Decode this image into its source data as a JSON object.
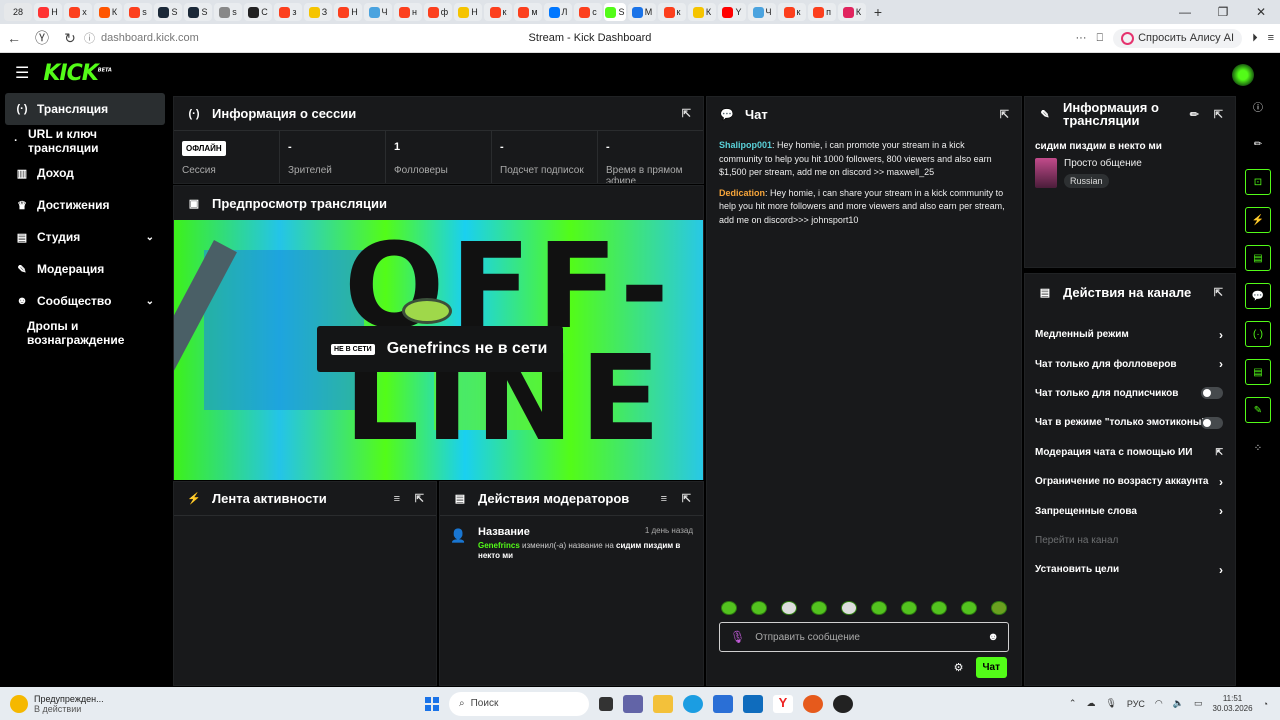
{
  "browser": {
    "tabs": [
      {
        "label": "28",
        "icon": "count-badge",
        "color": "#e6e8ea"
      },
      {
        "label": "Н",
        "icon": "yandex-icon",
        "color": "#ff3333"
      },
      {
        "label": "x",
        "icon": "yandex-icon",
        "color": "#fc3f1d"
      },
      {
        "label": "К",
        "icon": "kinopoisk-icon",
        "color": "#f50"
      },
      {
        "label": "s",
        "icon": "yandex-icon",
        "color": "#fc3f1d"
      },
      {
        "label": "S",
        "icon": "steam-icon",
        "color": "#1b2838"
      },
      {
        "label": "S",
        "icon": "steam-icon",
        "color": "#1b2838"
      },
      {
        "label": "s",
        "icon": "generic-icon",
        "color": "#888"
      },
      {
        "label": "С",
        "icon": "generic-icon",
        "color": "#222"
      },
      {
        "label": "з",
        "icon": "yandex-icon",
        "color": "#fc3f1d"
      },
      {
        "label": "З",
        "icon": "yellow-icon",
        "color": "#f5c400"
      },
      {
        "label": "Н",
        "icon": "yandex-icon",
        "color": "#fc3f1d"
      },
      {
        "label": "Ч",
        "icon": "image-icon",
        "color": "#4aa3df"
      },
      {
        "label": "н",
        "icon": "yandex-icon",
        "color": "#fc3f1d"
      },
      {
        "label": "ф",
        "icon": "yandex-icon",
        "color": "#fc3f1d"
      },
      {
        "label": "Н",
        "icon": "yellow-icon",
        "color": "#f5c400"
      },
      {
        "label": "к",
        "icon": "yandex-icon",
        "color": "#fc3f1d"
      },
      {
        "label": "м",
        "icon": "yandex-icon",
        "color": "#fc3f1d"
      },
      {
        "label": "Л",
        "icon": "vk-icon",
        "color": "#0077ff"
      },
      {
        "label": "с",
        "icon": "yandex-icon",
        "color": "#fc3f1d"
      },
      {
        "label": "S",
        "icon": "kick-icon",
        "color": "#53fc18"
      },
      {
        "label": "М",
        "icon": "mail-icon",
        "color": "#1a73e8"
      },
      {
        "label": "к",
        "icon": "yandex-icon",
        "color": "#fc3f1d"
      },
      {
        "label": "К",
        "icon": "yellow-icon",
        "color": "#f5c400"
      },
      {
        "label": "Y",
        "icon": "youtube-icon",
        "color": "#ff0000"
      },
      {
        "label": "Ч",
        "icon": "image-icon",
        "color": "#4aa3df"
      },
      {
        "label": "к",
        "icon": "yandex-icon",
        "color": "#fc3f1d"
      },
      {
        "label": "п",
        "icon": "yandex-icon",
        "color": "#fc3f1d"
      },
      {
        "label": "К",
        "icon": "twitch-icon",
        "color": "#e0245e"
      }
    ],
    "url": "dashboard.kick.com",
    "page_title": "Stream - Kick Dashboard",
    "alice_label": "Спросить Алису AI"
  },
  "app": {
    "logo": "KICK",
    "logo_badge": "BETA",
    "accent": "#53fc18"
  },
  "sidebar": {
    "items": [
      {
        "label": "Трансляция",
        "icon": "broadcast-icon",
        "glyph": "(·)",
        "active": true
      },
      {
        "label": "URL и ключ трансляции",
        "icon": "",
        "glyph": "·"
      },
      {
        "label": "Доход",
        "icon": "chart-icon",
        "glyph": "▥"
      },
      {
        "label": "Достижения",
        "icon": "trophy-icon",
        "glyph": "♛"
      },
      {
        "label": "Студия",
        "icon": "studio-icon",
        "glyph": "▤",
        "chevron": "⌄"
      },
      {
        "label": "Модерация",
        "icon": "wrench-icon",
        "glyph": "✎"
      },
      {
        "label": "Сообщество",
        "icon": "community-icon",
        "glyph": "☻",
        "chevron": "⌄"
      },
      {
        "label": "Дропы и вознаграждение",
        "icon": "",
        "glyph": ""
      }
    ]
  },
  "session": {
    "title": "Информация о сессии",
    "status_badge": "ОФЛАЙН",
    "stats": [
      {
        "value": "",
        "label": "Сессия"
      },
      {
        "value": "-",
        "label": "Зрителей"
      },
      {
        "value": "1",
        "label": "Фолловеры"
      },
      {
        "value": "-",
        "label": "Подсчет подписок"
      },
      {
        "value": "-",
        "label": "Время в прямом эфире"
      }
    ]
  },
  "preview": {
    "title": "Предпросмотр трансляции",
    "offline_art_text": "OFF-\nLINE",
    "offline_badge": "НЕ В СЕТИ",
    "offline_message": "Genefrincs не в сети"
  },
  "activity": {
    "title": "Лента активности"
  },
  "mod_actions": {
    "title": "Действия модераторов",
    "entries": [
      {
        "title": "Название",
        "time": "1 день назад",
        "user": "Genefrincs",
        "action": " изменил(-а) название на ",
        "value": "сидим пиздим в некто ми"
      }
    ]
  },
  "chat": {
    "title": "Чат",
    "messages": [
      {
        "user": "Shalipop001",
        "text": ": Hey homie, i can promote your stream in a kick community to help you hit 1000 followers, 800 viewers and also earn $1,500 per stream, add me on discord >> maxwell_25"
      },
      {
        "user": "Dedication",
        "text": ": Hey homie, i can share your stream in a kick community to help you hit more followers and more viewers and also earn per stream, add me on discord>>> johnsport10"
      }
    ],
    "input_placeholder": "Отправить сообщение",
    "send_label": "Чат"
  },
  "stream_info": {
    "title": "Информация о трансляции",
    "stream_title": "сидим пиздим в некто ми",
    "category": "Просто общение",
    "language_tag": "Russian"
  },
  "channel_actions": {
    "title": "Действия на канале",
    "items": [
      {
        "label": "Медленный режим",
        "control": "chevron"
      },
      {
        "label": "Чат только для фолловеров",
        "control": "chevron"
      },
      {
        "label": "Чат только для подписчиков",
        "control": "toggle",
        "on": false
      },
      {
        "label": "Чат в режиме \"только эмотиконы\"",
        "control": "toggle",
        "on": false
      },
      {
        "label": "Модерация чата с помощью ИИ",
        "control": "external"
      },
      {
        "label": "Ограничение по возрасту аккаунта",
        "control": "chevron"
      },
      {
        "label": "Запрещенные слова",
        "control": "chevron"
      },
      {
        "label": "Перейти на канал",
        "control": "none",
        "disabled": true
      },
      {
        "label": "Установить цели",
        "control": "chevron"
      }
    ]
  },
  "taskbar": {
    "notification_title": "Предупрежден...",
    "notification_sub": "В действии",
    "search_placeholder": "Поиск",
    "lang": "РУС",
    "time": "11:51",
    "date": "30.03.2026"
  }
}
